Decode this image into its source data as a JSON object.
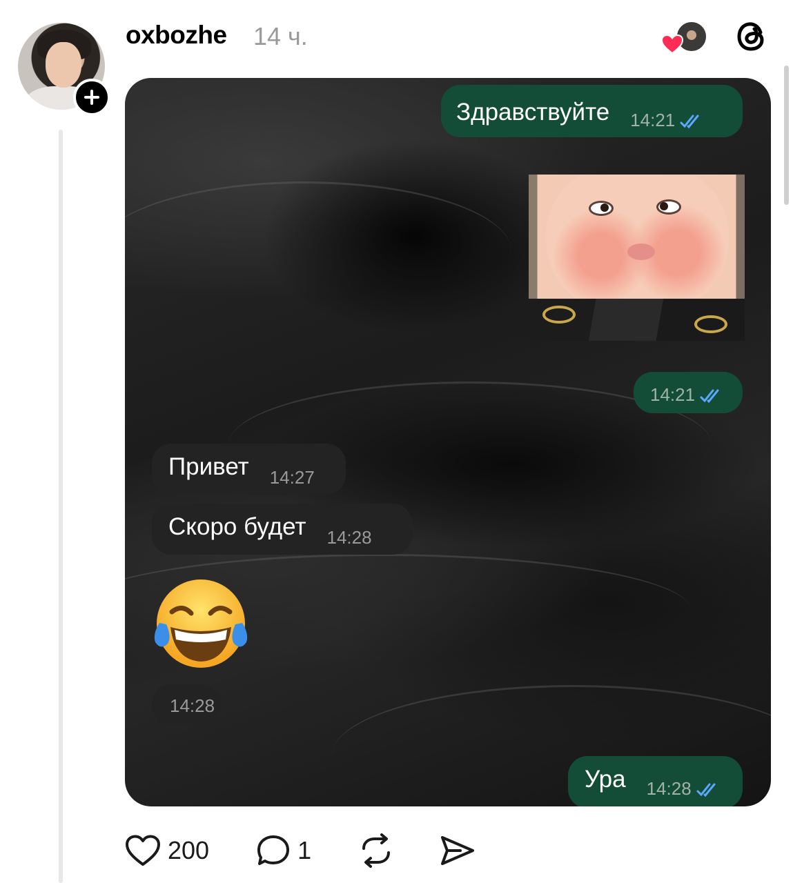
{
  "post": {
    "username": "oxbozhe",
    "time_ago": "14 ч."
  },
  "chat": {
    "messages": [
      {
        "direction": "out",
        "text": "Здравствуйте",
        "time": "14:21",
        "status": "read"
      },
      {
        "direction": "out",
        "type": "sticker",
        "text": "",
        "time": "14:21",
        "status": "read"
      },
      {
        "direction": "in",
        "text": "Привет",
        "time": "14:27"
      },
      {
        "direction": "in",
        "text": "Скоро будет",
        "time": "14:28"
      },
      {
        "direction": "in",
        "type": "emoji",
        "emoji": "face-with-tears-of-joy",
        "time": "14:28"
      },
      {
        "direction": "out",
        "text": "Ура",
        "time": "14:28",
        "status": "read"
      }
    ]
  },
  "actions": {
    "likes": "200",
    "replies": "1"
  },
  "colors": {
    "outgoing_bubble": "#144d37",
    "incoming_bubble": "#232323",
    "read_ticks": "#5aa9ff",
    "like_heart": "#ff2d55"
  }
}
